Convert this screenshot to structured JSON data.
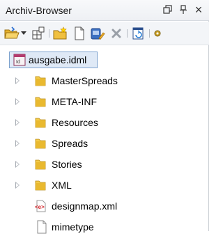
{
  "window": {
    "title": "Archiv-Browser",
    "controls": {
      "restore_icon": "restore-icon",
      "pin_icon": "pin-icon",
      "close_glyph": "×"
    }
  },
  "toolbar": {
    "icons": [
      "open-folder-icon",
      "dropdown-arrow-icon",
      "grid-add-icon",
      "new-folder-icon",
      "new-file-icon",
      "edit-icon",
      "delete-icon",
      "refresh-icon",
      "settings-icon"
    ]
  },
  "tree": {
    "root": {
      "label": "ausgabe.idml",
      "icon": "indesign-file-icon"
    },
    "items": [
      {
        "label": "MasterSpreads",
        "type": "folder",
        "expandable": true
      },
      {
        "label": "META-INF",
        "type": "folder",
        "expandable": true
      },
      {
        "label": "Resources",
        "type": "folder",
        "expandable": true
      },
      {
        "label": "Spreads",
        "type": "folder",
        "expandable": true
      },
      {
        "label": "Stories",
        "type": "folder",
        "expandable": true
      },
      {
        "label": "XML",
        "type": "folder",
        "expandable": true
      },
      {
        "label": "designmap.xml",
        "type": "xml-file",
        "expandable": false
      },
      {
        "label": "mimetype",
        "type": "file",
        "expandable": false
      }
    ]
  },
  "colors": {
    "folder": "#e9b92f",
    "selection_bg": "#dfe9f6",
    "selection_border": "#7da2ce",
    "xml_red": "#d4262b"
  }
}
